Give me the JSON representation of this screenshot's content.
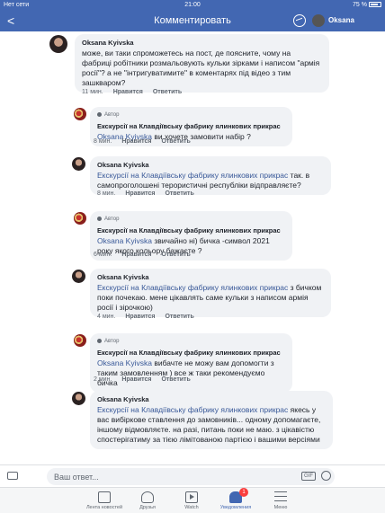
{
  "status_bar": {
    "carrier": "Нет сети",
    "time": "21:00",
    "battery": "75 %"
  },
  "nav": {
    "back": "<",
    "title": "Комментировать",
    "user_name": "Oksana"
  },
  "comments": [
    {
      "author": "Oksana Kyivska",
      "badge": "",
      "mention": "",
      "text": "може, ви таки спроможетесь на пост, де поясните, чому на фабриці робітники розмальовують кульки зірками і написом \"армія росії\"? а не \"інтригуватимите\" в коментарях під відео з тим зашкваром?",
      "time": "11 мин.",
      "like": "Нравится",
      "reply": "Ответить"
    },
    {
      "author": "Екскурсії на Клавдіївську фабрику ялинкових прикрас",
      "badge": "Автор",
      "mention": "Oksana Kyivska",
      "text": "ви хочете замовити набір ?",
      "time": "8 мин.",
      "like": "Нравится",
      "reply": "Ответить"
    },
    {
      "author": "Oksana Kyivska",
      "badge": "",
      "mention": "Екскурсії на Клавдіївську фабрику ялинкових прикрас",
      "text": "так. в самопроголошені терористичні республіки відправляєте?",
      "time": "8 мин.",
      "like": "Нравится",
      "reply": "Ответить"
    },
    {
      "author": "Екскурсії на Клавдіївську фабрику ялинкових прикрас",
      "badge": "Автор",
      "mention": "Oksana Kyivska",
      "text": "звичайно ні) бичка -символ 2021 року якого кольору бажаєте ?",
      "time": "6 мин.",
      "like": "Нравится",
      "reply": "Ответить"
    },
    {
      "author": "Oksana Kyivska",
      "badge": "",
      "mention": "Екскурсії на Клавдіївську фабрику ялинкових прикрас",
      "text": "з бичком поки почекаю. мене цікавлять саме кульки з написом армія росії і зірочкою)",
      "time": "4 мин.",
      "like": "Нравится",
      "reply": "Ответить"
    },
    {
      "author": "Екскурсії на Клавдіївську фабрику ялинкових прикрас",
      "badge": "Автор",
      "mention": "Oksana Kyivska",
      "text": "вибачте не можу вам допомогти з таким замовленням ) все ж таки рекомендуємо бичка",
      "time": "2 мин.",
      "like": "Нравится",
      "reply": "Ответить"
    },
    {
      "author": "Oksana Kyivska",
      "badge": "",
      "mention": "Екскурсії на Клавдіївську фабрику ялинкових прикрас",
      "text": "якесь у вас вибіркове ставлення до замовників... одному допомагаєте, іншому відмовляєте. на разі, питань поки не маю. з цікавістю спостерігатиму за тією лімітованою партією і вашими версіями",
      "time": "",
      "like": "",
      "reply": ""
    }
  ],
  "composer": {
    "placeholder": "Ваш ответ...",
    "gif": "GIF"
  },
  "tabs": [
    {
      "label": "Лента новостей",
      "icon": "news-feed-icon"
    },
    {
      "label": "Друзья",
      "icon": "friends-icon"
    },
    {
      "label": "Watch",
      "icon": "watch-icon"
    },
    {
      "label": "Уведомления",
      "icon": "bell-icon",
      "badge": "1"
    },
    {
      "label": "Меню",
      "icon": "menu-icon"
    }
  ]
}
